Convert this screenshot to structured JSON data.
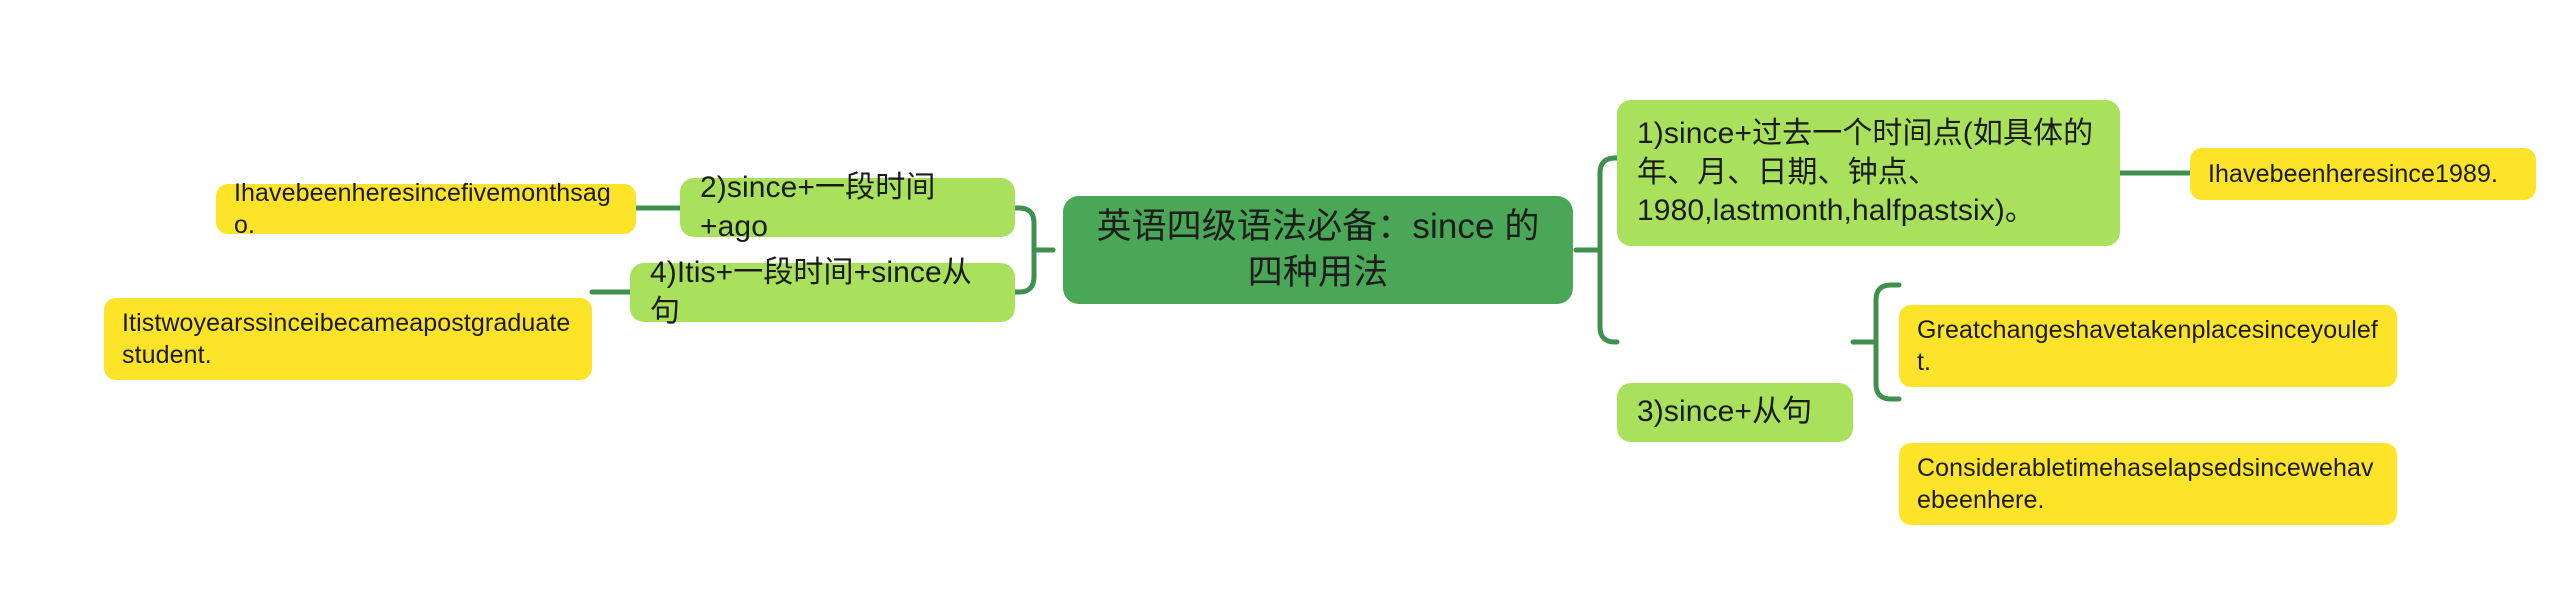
{
  "mindmap": {
    "title": "英语四级语法必备：since 的四种用法",
    "colors": {
      "root_fill": "#4aa757",
      "branch_fill": "#a9e05c",
      "leaf_fill": "#fde428",
      "connector": "#3f8f4f",
      "background": "#ffffff",
      "text": "#1b1b1b"
    },
    "root": {
      "label": "英语四级语法必备：since 的四种用法"
    },
    "branches": {
      "usage1": "1)since+过去一个时间点(如具体的年、月、日期、钟点、1980,lastmonth,halfpastsix)。",
      "usage2": "2)since+一段时间+ago",
      "usage3": "3)since+从句",
      "usage4": "4)Itis+一段时间+since从句"
    },
    "examples": {
      "example1": "Ihavebeenheresince1989.",
      "example2": "Ihavebeenheresincefivemonthsago.",
      "example3a": "Greatchangeshavetakenplacesinceyouleft.",
      "example3b": "Considerabletimehaselapsedsincewehavebeenhere.",
      "example4": "Itistwoyearssinceibecameapostgraduatestudent."
    }
  }
}
